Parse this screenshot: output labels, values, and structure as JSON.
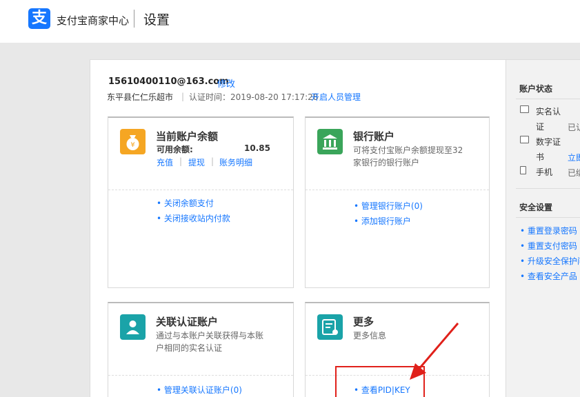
{
  "header": {
    "logo_glyph": "支",
    "brand": "支付宝商家中心",
    "page_title": "设置"
  },
  "account": {
    "email": "15610400110@163.com",
    "edit_label": "修改",
    "shop_name": "东平县仁仁乐超市",
    "separator": "|",
    "cert_time": "认证时间：2019-08-20 17:17:28",
    "manage_label": "开启人员管理"
  },
  "cards": {
    "balance": {
      "title": "当前账户余额",
      "available_label": "可用余额:",
      "available_value": "10.85",
      "actions": [
        "充值",
        "提现",
        "账务明细"
      ],
      "links": [
        "关闭余额支付",
        "关闭接收站内付款"
      ]
    },
    "bank": {
      "title": "银行账户",
      "desc": "可将支付宝账户余额提现至32家银行的银行账户",
      "links": [
        "管理银行账户(0)",
        "添加银行账户"
      ]
    },
    "linked": {
      "title": "关联认证账户",
      "desc": "通过与本账户关联获得与本账户相同的实名认证",
      "links": [
        "管理关联认证账户(0)"
      ]
    },
    "more": {
      "title": "更多",
      "desc": "更多信息",
      "links": [
        "查看PID|KEY"
      ]
    }
  },
  "sidebar": {
    "status_title": "账户状态",
    "status_items": [
      {
        "label": "实名认证",
        "value": "已认"
      },
      {
        "label": "数字证书",
        "value": "立即"
      },
      {
        "label": "手机",
        "value": "已绑"
      }
    ],
    "security_title": "安全设置",
    "security_links": [
      "重置登录密码",
      "重置支付密码",
      "升级安全保护问题",
      "查看安全产品"
    ]
  },
  "colors": {
    "accent": "#1677ff",
    "highlight": "#e0201a",
    "balance_icon": "#f5a623",
    "bank_icon": "#3aa55a",
    "linked_icon": "#1aa3a8",
    "more_icon": "#1aa3a8"
  }
}
